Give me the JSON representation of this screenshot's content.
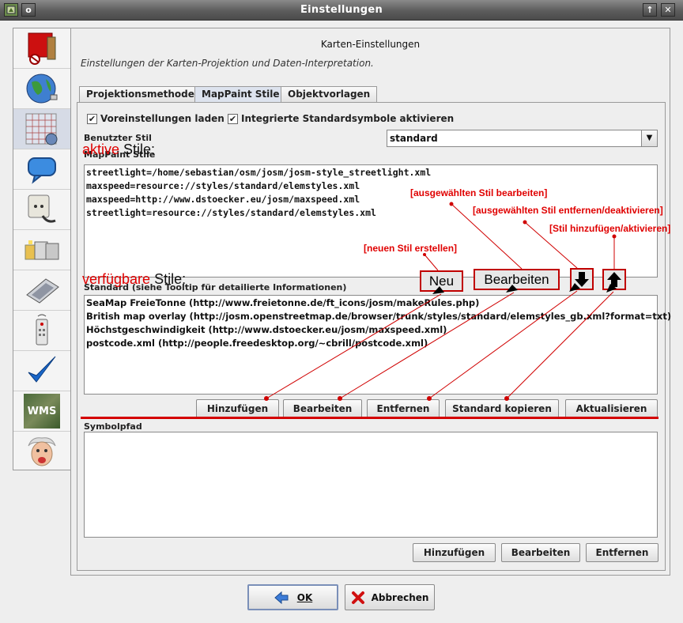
{
  "window": {
    "title": "Einstellungen",
    "left_icons": [
      "app-menu-icon",
      "pin-icon"
    ],
    "right_icons": [
      "maximize-icon",
      "close-icon"
    ]
  },
  "sidebar": {
    "items": [
      {
        "name": "display-preferences-icon"
      },
      {
        "name": "globe-icon"
      },
      {
        "name": "map-grid-icon",
        "active": true
      },
      {
        "name": "speech-bubble-icon"
      },
      {
        "name": "plug-icon"
      },
      {
        "name": "folders-icon"
      },
      {
        "name": "graphics-tablet-icon"
      },
      {
        "name": "remote-control-icon"
      },
      {
        "name": "checkmark-icon"
      },
      {
        "name": "wms-icon",
        "label": "WMS"
      },
      {
        "name": "einstein-face-icon"
      }
    ]
  },
  "header": {
    "title": "Karten-Einstellungen",
    "description": "Einstellungen der Karten-Projektion und Daten-Interpretation."
  },
  "tabs": [
    {
      "label": "Projektionsmethode"
    },
    {
      "label": "MapPaint Stile",
      "active": true
    },
    {
      "label": "Objektvorlagen"
    }
  ],
  "options": {
    "load_defaults": {
      "label": "Voreinstellungen laden",
      "checked": true
    },
    "builtin_symbols": {
      "label": "Integrierte Standardsymbole aktivieren",
      "checked": true
    }
  },
  "user_style": {
    "label": "Benutzter Stil",
    "value": "standard"
  },
  "active_styles": {
    "label": "MapPaint Stile",
    "items": [
      "streetlight=/home/sebastian/osm/josm/josm-style_streetlight.xml",
      "maxspeed=resource://styles/standard/elemstyles.xml",
      "maxspeed=http://www.dstoecker.eu/josm/maxspeed.xml",
      "streetlight=resource://styles/standard/elemstyles.xml"
    ]
  },
  "available_styles": {
    "label": "Standard (siehe Tooltip für detailierte Informationen)",
    "items": [
      "SeaMap FreieTonne (http://www.freietonne.de/ft_icons/josm/makeRules.php)",
      "British map overlay (http://josm.openstreetmap.de/browser/trunk/styles/standard/elemstyles_gb.xml?format=txt)",
      "Höchstgeschwindigkeit (http://www.dstoecker.eu/josm/maxspeed.xml)",
      "postcode.xml (http://people.freedesktop.org/~cbrill/postcode.xml)"
    ],
    "buttons": {
      "add": "Hinzufügen",
      "edit": "Bearbeiten",
      "remove": "Entfernen",
      "copy_default": "Standard kopieren",
      "update": "Aktualisieren"
    }
  },
  "symbol_path": {
    "label": "Symbolpfad",
    "buttons": {
      "add": "Hinzufügen",
      "edit": "Bearbeiten",
      "remove": "Entfernen"
    }
  },
  "annotations": {
    "active_red": "aktive",
    "active_black": " Stile:",
    "available_red": "verfügbare",
    "available_black": " Stile:",
    "new_style": "[neuen Stil erstellen]",
    "edit_selected": "[ausgewählten Stil bearbeiten]",
    "remove_selected": "[ausgewählten Stil entfernen/deaktivieren]",
    "add_style": "[Stil hinzufügen/aktivieren]",
    "button_new": "Neu",
    "button_edit": "Bearbeiten",
    "arrow_down": "arrow-down-icon",
    "arrow_up": "arrow-up-icon"
  },
  "dialog_buttons": {
    "ok": "OK",
    "cancel": "Abbrechen"
  },
  "colors": {
    "annotation_red": "#e00000",
    "titlebar": "#5c5c5c",
    "active_tab": "#dde3ee"
  }
}
